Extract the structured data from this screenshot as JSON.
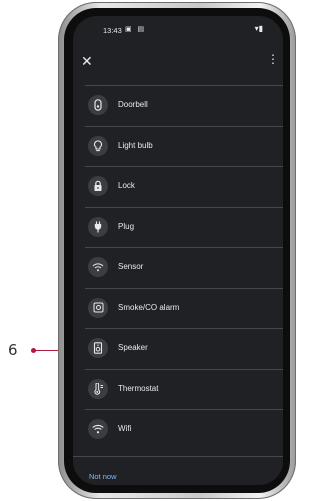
{
  "callout": {
    "number": "6"
  },
  "status_bar": {
    "time": "13:43",
    "left_icons": "▣ ▤",
    "right_icons": "▾▮"
  },
  "header": {
    "close_glyph": "✕",
    "more_glyph": "⋮"
  },
  "items": [
    {
      "label": "Doorbell",
      "icon": "doorbell-icon"
    },
    {
      "label": "Light bulb",
      "icon": "light-bulb-icon"
    },
    {
      "label": "Lock",
      "icon": "lock-icon"
    },
    {
      "label": "Plug",
      "icon": "plug-icon"
    },
    {
      "label": "Sensor",
      "icon": "sensor-icon"
    },
    {
      "label": "Smoke/CO alarm",
      "icon": "smoke-alarm-icon"
    },
    {
      "label": "Speaker",
      "icon": "speaker-icon"
    },
    {
      "label": "Thermostat",
      "icon": "thermostat-icon"
    },
    {
      "label": "Wifi",
      "icon": "wifi-icon"
    }
  ],
  "footer": {
    "not_now": "Not now"
  },
  "colors": {
    "screen_bg": "#202124",
    "accent": "#8ab4f8",
    "callout": "#b01a3c"
  }
}
